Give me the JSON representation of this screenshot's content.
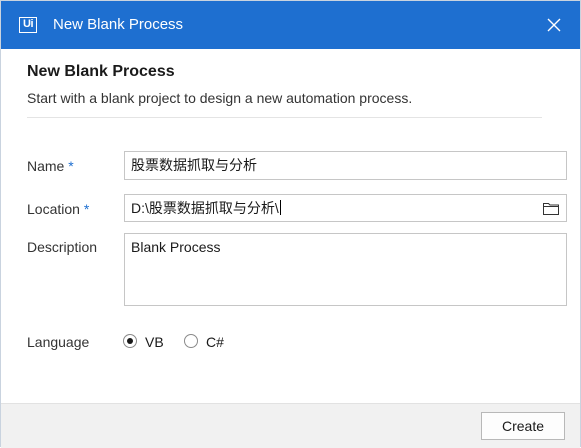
{
  "window": {
    "app_icon_text": "Ui",
    "title": "New Blank Process",
    "close_icon": "close-icon",
    "accent_color": "#1e6fd0"
  },
  "header": {
    "title": "New Blank Process",
    "subtitle": "Start with a blank project to design a new automation process."
  },
  "form": {
    "name": {
      "label": "Name",
      "required_mark": "*",
      "value": "股票数据抓取与分析"
    },
    "location": {
      "label": "Location",
      "required_mark": "*",
      "value": "D:\\股票数据抓取与分析\\",
      "browse_icon": "folder-icon"
    },
    "description": {
      "label": "Description",
      "value": "Blank Process"
    },
    "language": {
      "label": "Language",
      "options": [
        {
          "label": "VB",
          "selected": true
        },
        {
          "label": "C#",
          "selected": false
        }
      ]
    }
  },
  "footer": {
    "create_label": "Create"
  }
}
